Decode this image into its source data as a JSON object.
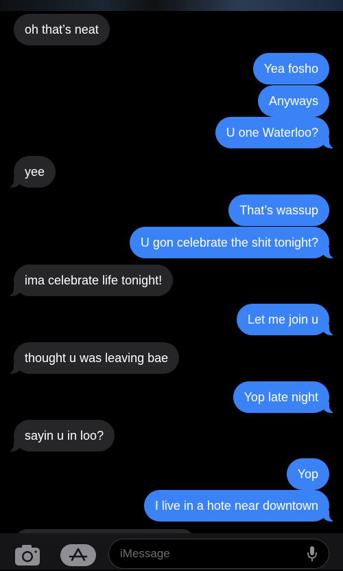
{
  "conversation": {
    "messages": [
      {
        "from": "them",
        "text": "oh that’s neat"
      },
      {
        "from": "me",
        "text": "Yea fosho"
      },
      {
        "from": "me",
        "text": "Anyways"
      },
      {
        "from": "me",
        "text": "U one Waterloo?"
      },
      {
        "from": "them",
        "text": "yee"
      },
      {
        "from": "me",
        "text": "That’s wassup"
      },
      {
        "from": "me",
        "text": "U gon celebrate the shit tonight?"
      },
      {
        "from": "them",
        "text": "ima celebrate life tonight!"
      },
      {
        "from": "me",
        "text": "Let me join u"
      },
      {
        "from": "them",
        "text": "thought u was leaving bae"
      },
      {
        "from": "me",
        "text": "Yop late night"
      },
      {
        "from": "them",
        "text": "sayin u in loo?"
      },
      {
        "from": "me",
        "text": "Yop"
      },
      {
        "from": "me",
        "text": "I live in a hote near downtown"
      }
    ]
  },
  "input_bar": {
    "placeholder": "iMessage",
    "camera_icon": "camera-icon",
    "apps_icon": "app-store-icon",
    "mic_icon": "microphone-icon"
  },
  "colors": {
    "sent_bubble": "#3b82f6",
    "received_bubble": "#262628",
    "background": "#000000"
  }
}
